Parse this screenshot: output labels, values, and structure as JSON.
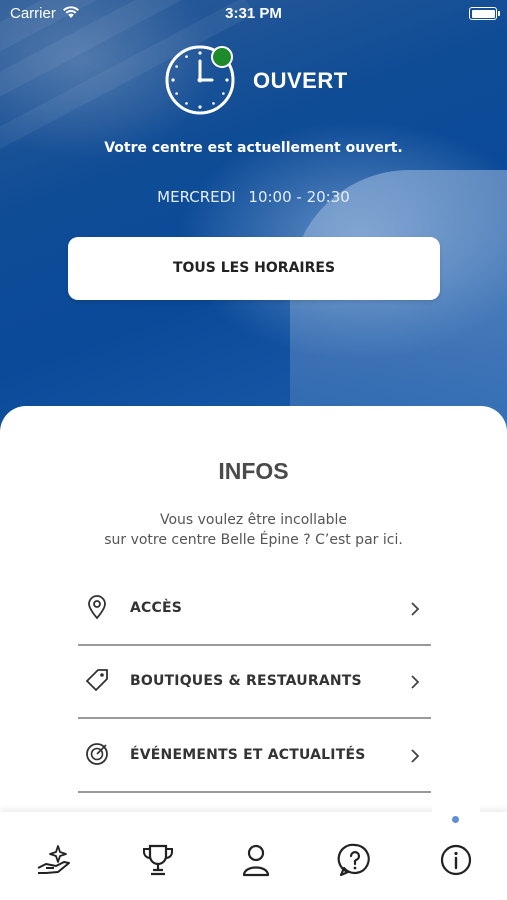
{
  "status_bar": {
    "carrier": "Carrier",
    "time": "3:31 PM"
  },
  "opening": {
    "status_label": "OUVERT",
    "status_color": "#1f8a2a",
    "message": "Votre centre est actuellement ouvert.",
    "day": "MERCREDI",
    "hours": "10:00 - 20:30",
    "all_hours_button": "TOUS LES HORAIRES"
  },
  "info": {
    "title": "INFOS",
    "subtitle_line1": "Vous voulez être incollable",
    "subtitle_line2": "sur votre centre Belle Épine ? C’est par ici.",
    "items": [
      {
        "label": "ACCÈS",
        "icon": "location-pin-icon"
      },
      {
        "label": "BOUTIQUES & RESTAURANTS",
        "icon": "tag-icon"
      },
      {
        "label": "ÉVÉNEMENTS ET ACTUALITÉS",
        "icon": "target-icon"
      }
    ]
  },
  "tab_bar": {
    "tabs": [
      {
        "icon": "hand-sparkle-icon"
      },
      {
        "icon": "trophy-icon"
      },
      {
        "icon": "user-icon"
      },
      {
        "icon": "help-icon"
      },
      {
        "icon": "info-icon",
        "active": true
      }
    ],
    "active_color": "#5b8fd6"
  }
}
